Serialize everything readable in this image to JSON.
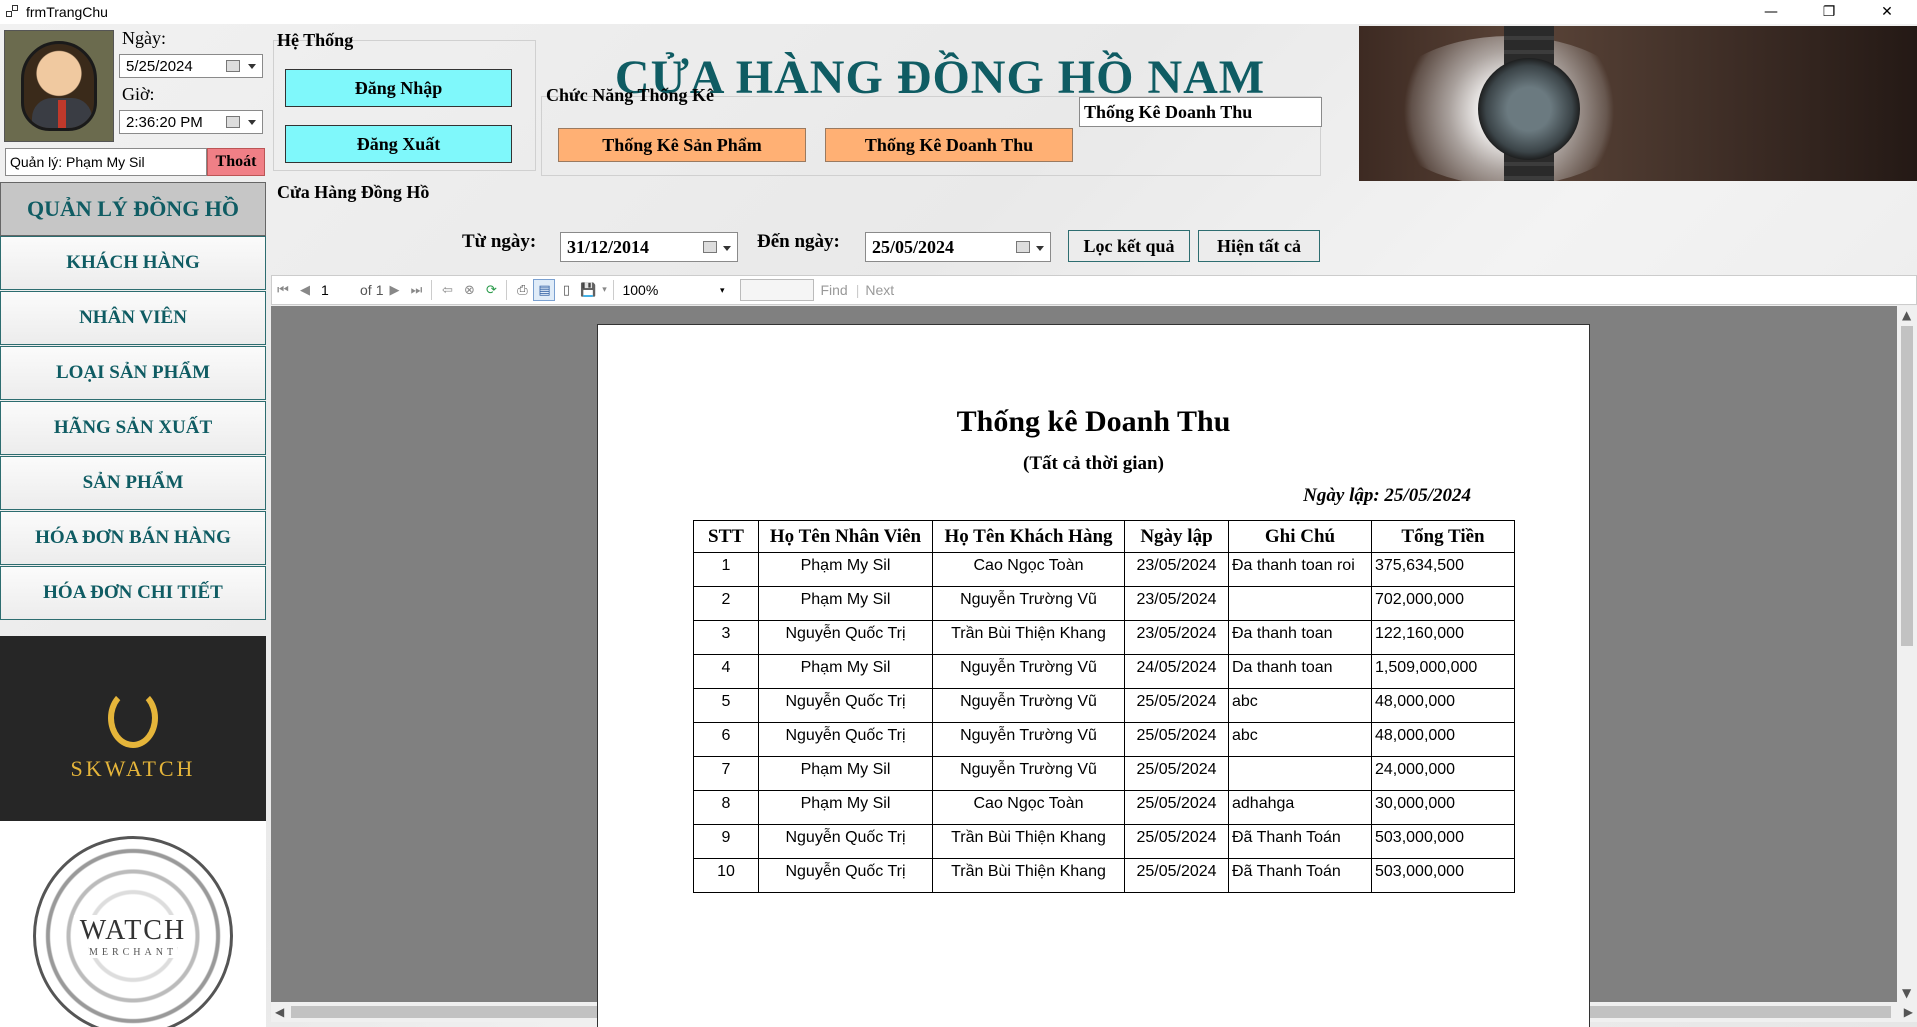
{
  "window": {
    "title": "frmTrangChu",
    "minimize": "—",
    "restore": "❐",
    "close": "✕"
  },
  "user_panel": {
    "date_label": "Ngày:",
    "date_value": "5/25/2024",
    "time_label": "Giờ:",
    "time_value": "2:36:20 PM",
    "manager_text": "Quản lý: Phạm My Sil",
    "logout_label": "Thoát"
  },
  "system_group": {
    "title": "Hệ Thống",
    "login_label": "Đăng Nhập",
    "logout_label": "Đăng Xuất"
  },
  "shop_title": "CỬA HÀNG ĐỒNG HỒ NAM",
  "stats_group": {
    "title": "Chức Năng Thống Kê",
    "product_stats_label": "Thống Kê Sản Phẩm",
    "revenue_stats_label": "Thống Kê Doanh Thu",
    "current_view": "Thống Kê Doanh Thu"
  },
  "sidebar": {
    "header": "QUẢN LÝ ĐỒNG HỒ",
    "items": [
      {
        "label": "KHÁCH HÀNG"
      },
      {
        "label": "NHÂN VIÊN"
      },
      {
        "label": "LOẠI SẢN PHẨM"
      },
      {
        "label": "HÃNG SẢN XUẤT"
      },
      {
        "label": "SẢN PHẨM"
      },
      {
        "label": "HÓA ĐƠN BÁN HÀNG"
      },
      {
        "label": "HÓA ĐƠN CHI TIẾT"
      }
    ],
    "brand_logo_text": "SKWATCH",
    "merchant_logo_text": "WATCH",
    "merchant_logo_sub": "MERCHANT"
  },
  "store_group": {
    "title": "Cửa Hàng Đồng Hồ",
    "from_label": "Từ ngày:",
    "from_value": "31/12/2014",
    "to_label": "Đến ngày:",
    "to_value": "25/05/2024",
    "filter_label": "Lọc kết quả",
    "show_all_label": "Hiện tất cả"
  },
  "report_toolbar": {
    "page_current": "1",
    "page_of": "of",
    "page_total": "1",
    "zoom": "100%",
    "find_label": "Find",
    "next_label": "Next"
  },
  "report": {
    "title": "Thống kê Doanh Thu",
    "subtitle": "(Tất cả thời gian)",
    "created_date": "Ngày lập: 25/05/2024",
    "columns": [
      "STT",
      "Họ Tên Nhân Viên",
      "Họ Tên Khách Hàng",
      "Ngày lập",
      "Ghi Chú",
      "Tổng Tiền"
    ],
    "rows": [
      [
        "1",
        "Phạm My Sil",
        "Cao Ngọc Toàn",
        "23/05/2024",
        "Đa thanh toan roi",
        "375,634,500"
      ],
      [
        "2",
        "Phạm My Sil",
        "Nguyễn Trường Vũ",
        "23/05/2024",
        "",
        "702,000,000"
      ],
      [
        "3",
        "Nguyễn Quốc Trị",
        "Trần Bùi Thiện Khang",
        "23/05/2024",
        "Đa thanh toan",
        "122,160,000"
      ],
      [
        "4",
        "Phạm My Sil",
        "Nguyễn Trường Vũ",
        "24/05/2024",
        "Da thanh toan",
        "1,509,000,000"
      ],
      [
        "5",
        "Nguyễn Quốc Trị",
        "Nguyễn Trường Vũ",
        "25/05/2024",
        "abc",
        "48,000,000"
      ],
      [
        "6",
        "Nguyễn Quốc Trị",
        "Nguyễn Trường Vũ",
        "25/05/2024",
        "abc",
        "48,000,000"
      ],
      [
        "7",
        "Phạm My Sil",
        "Nguyễn Trường Vũ",
        "25/05/2024",
        "",
        "24,000,000"
      ],
      [
        "8",
        "Phạm My Sil",
        "Cao Ngọc Toàn",
        "25/05/2024",
        "adhahga",
        "30,000,000"
      ],
      [
        "9",
        "Nguyễn Quốc Trị",
        "Trần Bùi Thiện Khang",
        "25/05/2024",
        "Đã Thanh Toán",
        "503,000,000"
      ],
      [
        "10",
        "Nguyễn Quốc Trị",
        "Trần Bùi Thiện Khang",
        "25/05/2024",
        "Đã Thanh Toán",
        "503,000,000"
      ]
    ]
  },
  "colors": {
    "title_teal": "#0f5c63",
    "cyan_button": "#7ff8fb",
    "orange_button": "#ffb074",
    "logout_red": "#f07f86",
    "brand_gold": "#e5b53a"
  }
}
